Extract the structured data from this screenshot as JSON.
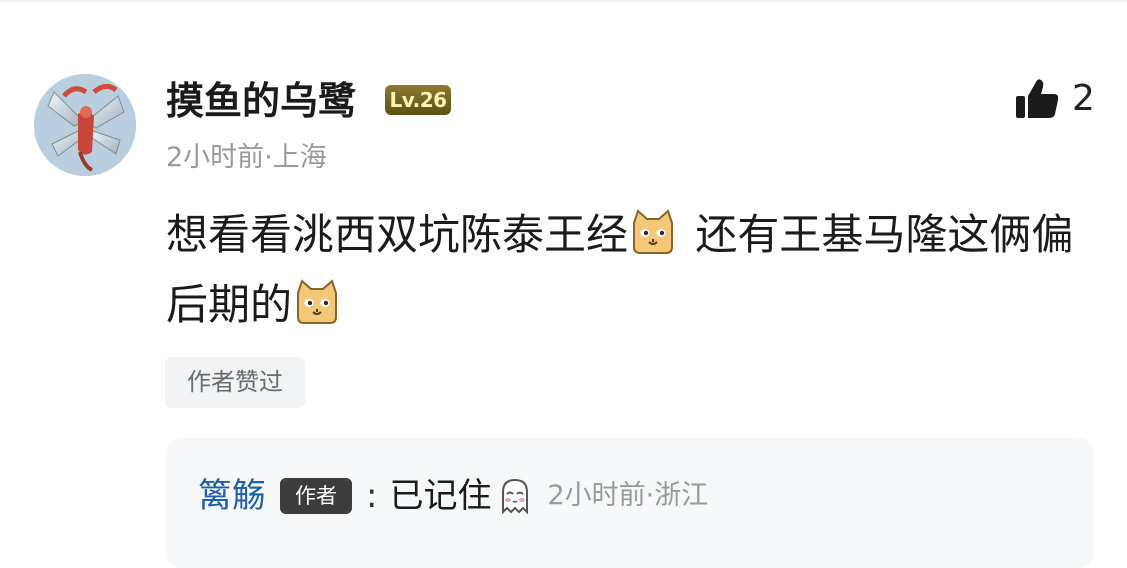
{
  "comment": {
    "username": "摸鱼的乌鹭",
    "level": "Lv.26",
    "likes": "2",
    "time": "2小时前",
    "separator": "·",
    "location": "上海",
    "text_part1": "想看看洮西双坑陈泰王经",
    "text_part2": " 还有王基马隆这俩偏后期的",
    "author_liked": "作者赞过",
    "emoji": "cat-face-emoji"
  },
  "reply": {
    "username": "篱觞",
    "badge": "作者",
    "colon": ":",
    "text": "已记住",
    "emoji": "shy-ghost-emoji",
    "time": "2小时前",
    "separator": "·",
    "location": "浙江"
  },
  "icons": {
    "like": "thumbs-up-icon"
  },
  "colors": {
    "username_link": "#1e5fa8",
    "level_badge": "#6e5d1f",
    "meta_text": "#9a9a9a",
    "reply_background": "#f7f8fa"
  }
}
